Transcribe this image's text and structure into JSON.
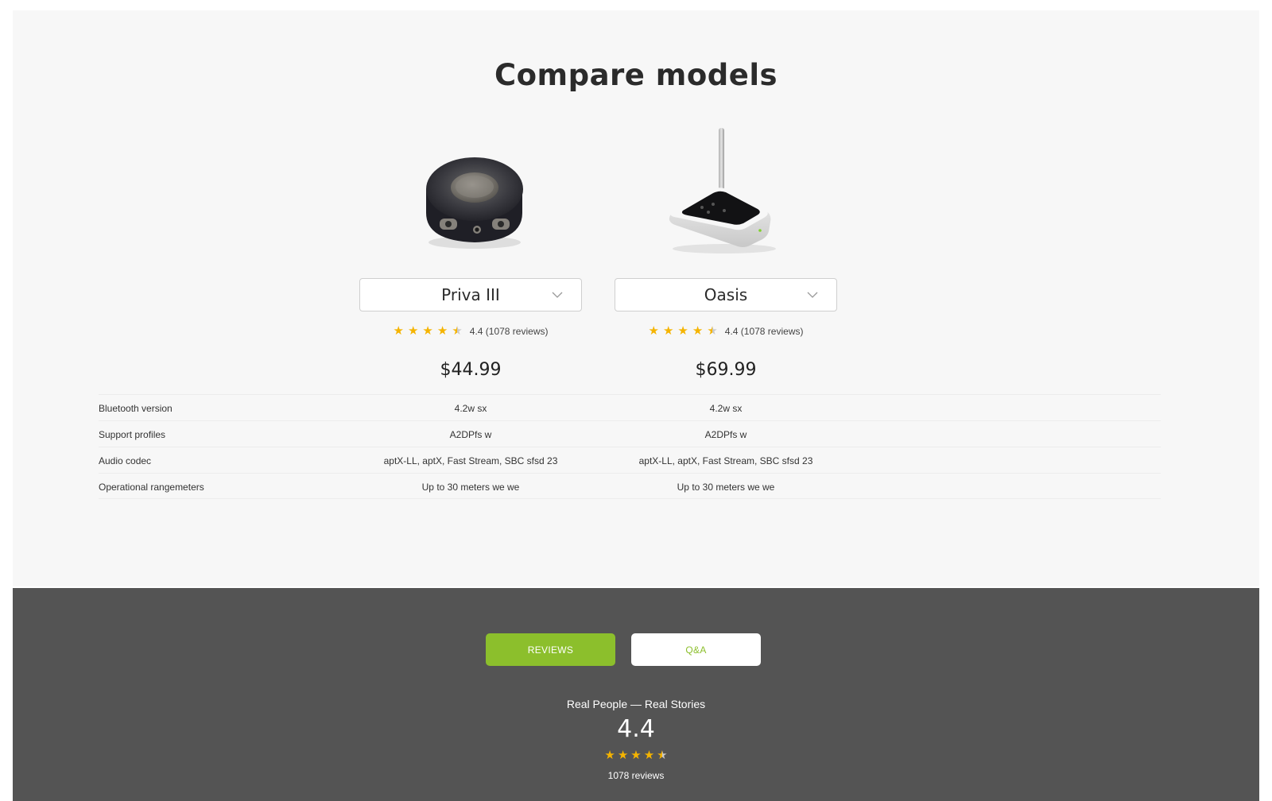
{
  "compare": {
    "title": "Compare models",
    "products": [
      {
        "image_icon": "puck-receiver-image",
        "model": "Priva III",
        "rating": 4.4,
        "rating_text": "4.4 (1078 reviews)",
        "price": "$44.99"
      },
      {
        "image_icon": "antenna-transmitter-image",
        "model": "Oasis",
        "rating": 4.4,
        "rating_text": "4.4 (1078 reviews)",
        "price": "$69.99"
      }
    ],
    "specs": [
      {
        "label": "Bluetooth version",
        "values": [
          "4.2w sx",
          "4.2w sx"
        ]
      },
      {
        "label": "Support profiles",
        "values": [
          "A2DPfs w",
          "A2DPfs w"
        ]
      },
      {
        "label": "Audio codec",
        "values": [
          "aptX-LL, aptX, Fast Stream, SBC sfsd 23",
          "aptX-LL, aptX, Fast Stream, SBC sfsd 23"
        ]
      },
      {
        "label": "Operational rangemeters",
        "values": [
          "Up to 30 meters we we",
          "Up to 30 meters we we"
        ]
      }
    ]
  },
  "reviews": {
    "tabs": [
      "REVIEWS",
      "Q&A"
    ],
    "active_tab": "REVIEWS",
    "tagline": "Real People — Real Stories",
    "rating": "4.4",
    "rating_value": 4.4,
    "count_text": "1078 reviews"
  },
  "colors": {
    "accent_green": "#8cbf2c",
    "star_gold": "#f5b400",
    "dark_band": "#545454"
  }
}
